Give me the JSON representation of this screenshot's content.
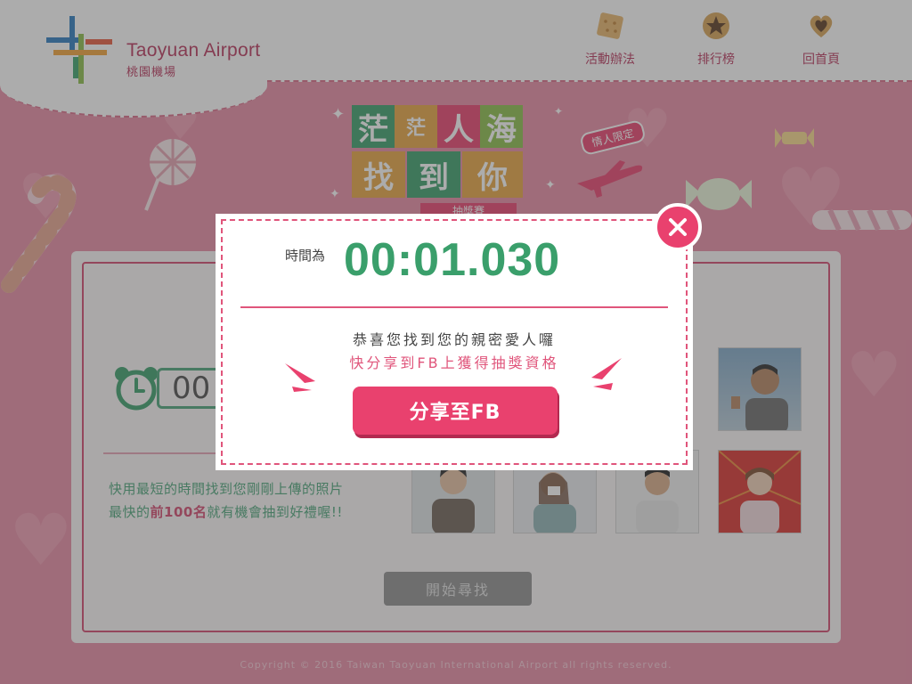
{
  "header": {
    "brand_name": "Taoyuan Airport",
    "brand_sub": "桃園機場",
    "nav": [
      {
        "label": "活動辦法",
        "icon": "cracker-icon"
      },
      {
        "label": "排行榜",
        "icon": "star-cookie-icon"
      },
      {
        "label": "回首頁",
        "icon": "heart-cookie-icon"
      }
    ]
  },
  "title_board": {
    "tiles": [
      "茫",
      "茫",
      "人",
      "海",
      "找",
      "到",
      "你"
    ],
    "ribbon": "抽獎賽",
    "badge": "情人限定"
  },
  "game": {
    "timer_text": "00",
    "description_line1": "快用最短的時間找到您剛剛上傳的照片",
    "description_line2_pre": "最快的",
    "description_line2_bold": "前100名",
    "description_line2_post": "就有機會抽到好禮喔!!",
    "start_button": "開始尋找"
  },
  "modal": {
    "time_label": "時間為",
    "time_value": "00:01.030",
    "message1": "恭喜您找到您的親密愛人囉",
    "message2": "快分享到FB上獲得抽獎資格",
    "share_button": "分享至FB"
  },
  "footer": "Copyright © 2016 Taiwan Taoyuan International Airport all rights reserved.",
  "colors": {
    "accent_pink": "#e9416e",
    "accent_green": "#3a9f6b",
    "background_pink": "#e88aa4"
  }
}
